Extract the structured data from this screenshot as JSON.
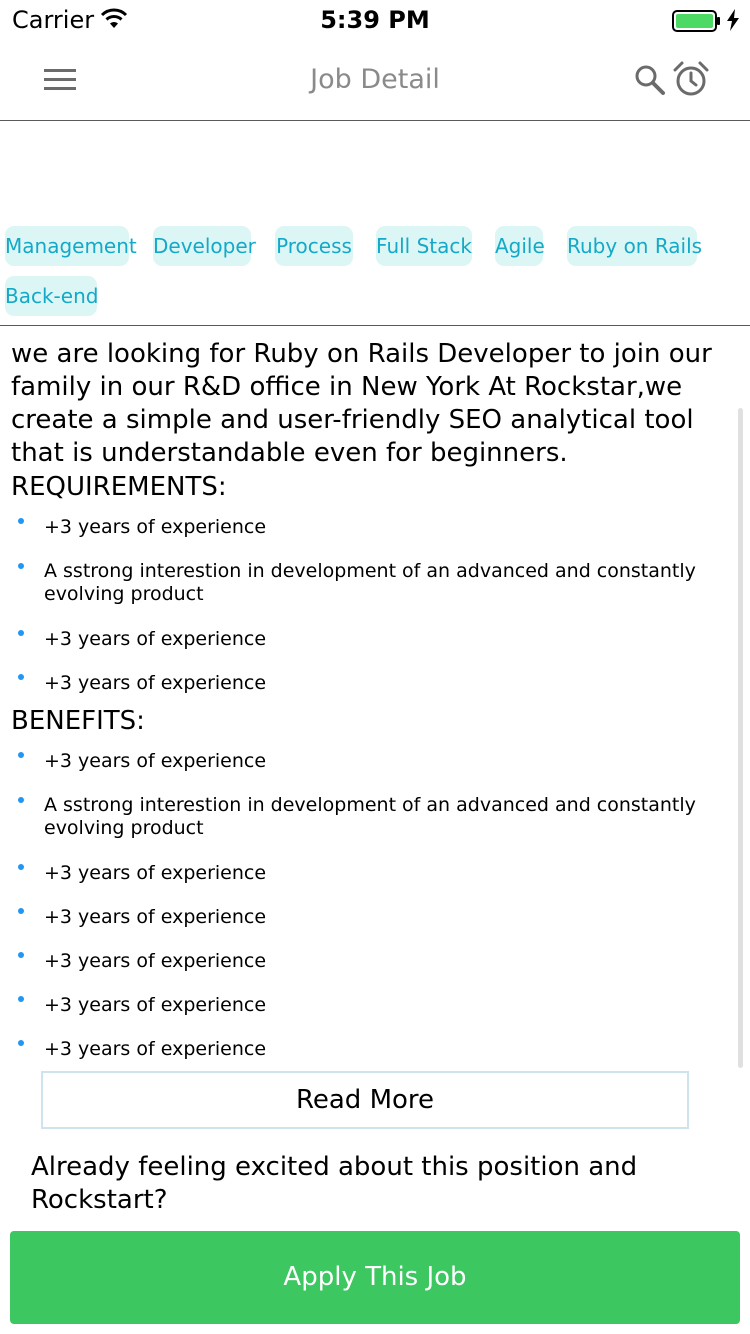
{
  "status_bar": {
    "carrier": "Carrier",
    "time": "5:39 PM",
    "battery_color": "#4cd964"
  },
  "nav": {
    "title": "Job Detail",
    "icons": [
      "menu-icon",
      "search-icon",
      "alarm-icon"
    ]
  },
  "tags": {
    "items": [
      "Management",
      "Developer",
      "Process",
      "Full Stack",
      "Agile",
      "Ruby on Rails",
      "Back-end"
    ],
    "color": "#14a9c8",
    "background": "#dcf6f5"
  },
  "job": {
    "intro": "we are looking for Ruby on Rails Developer to join our family in our R&D office in New York At Rockstar,we create a simple and user-friendly SEO analytical tool that is understandable even for beginners.",
    "requirements_heading": "REQUIREMENTS:",
    "requirements": [
      "+3 years of experience",
      "A sstrong interestion in development of an advanced and constantly evolving product",
      "+3 years of experience",
      "+3 years of experience"
    ],
    "benefits_heading": "BENEFITS:",
    "benefits": [
      "+3 years of experience",
      "A sstrong interestion in development of an advanced and constantly evolving product",
      "+3 years of experience",
      "+3 years of experience",
      "+3 years of experience",
      "+3 years of experience",
      "+3 years of experience"
    ]
  },
  "read_more_label": "Read More",
  "excited_text": "Already feeling excited about this position and Rockstart?",
  "apply": {
    "label": "Apply This Job",
    "color": "#3dc760"
  }
}
